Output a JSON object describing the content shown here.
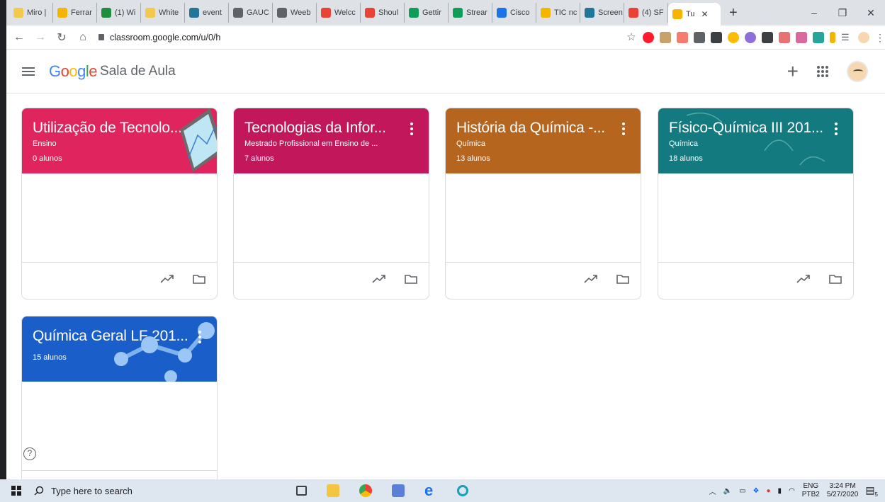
{
  "browser": {
    "tabs": [
      {
        "label": "Miro |",
        "color": "#f2c94c"
      },
      {
        "label": "Ferrar",
        "color": "#f4b400"
      },
      {
        "label": "(1) Wi",
        "color": "#1e8e3e"
      },
      {
        "label": "White",
        "color": "#f2c94c"
      },
      {
        "label": "event",
        "color": "#21759b"
      },
      {
        "label": "GAUC",
        "color": "#5f6368"
      },
      {
        "label": "Weeb",
        "color": "#5f6368"
      },
      {
        "label": "Welcc",
        "color": "#ea4335"
      },
      {
        "label": "Shoul",
        "color": "#ea4335"
      },
      {
        "label": "Gettir",
        "color": "#0f9d58"
      },
      {
        "label": "Strear",
        "color": "#0f9d58"
      },
      {
        "label": "Cisco",
        "color": "#1a73e8"
      },
      {
        "label": "TIC nc",
        "color": "#f4b400"
      },
      {
        "label": "Screen",
        "color": "#21759b"
      },
      {
        "label": "(4) SF",
        "color": "#ea4335"
      },
      {
        "label": "Tu",
        "color": "#f4b400"
      }
    ],
    "new_tab": "+",
    "window_controls": {
      "minimize": "–",
      "restore": "❐",
      "close": "✕"
    },
    "url": "classroom.google.com/u/0/h"
  },
  "header": {
    "logo_letters": [
      {
        "ch": "G",
        "color": "#4285f4"
      },
      {
        "ch": "o",
        "color": "#ea4335"
      },
      {
        "ch": "o",
        "color": "#fbbc05"
      },
      {
        "ch": "g",
        "color": "#4285f4"
      },
      {
        "ch": "l",
        "color": "#34a853"
      },
      {
        "ch": "e",
        "color": "#ea4335"
      }
    ],
    "product": "Sala de Aula",
    "create_label": "+"
  },
  "courses": [
    {
      "title": "Utilização de Tecnolo...",
      "section": "Ensino",
      "students": "0 alunos",
      "color": "#e0245e",
      "theme": "tablet",
      "kebab": false
    },
    {
      "title": "Tecnologias da Infor...",
      "section": "Mestrado Profissional em Ensino de ...",
      "students": "7 alunos",
      "color": "#c2185b",
      "theme": "plain",
      "kebab": true
    },
    {
      "title": "História da Química -...",
      "section": "Química",
      "students": "13 alunos",
      "color": "#b5651d",
      "theme": "plain",
      "kebab": true
    },
    {
      "title": "Físico-Química III 201...",
      "section": "Química",
      "students": "18 alunos",
      "color": "#137a7f",
      "theme": "chalk",
      "kebab": true
    },
    {
      "title": "Química Geral LF 201...",
      "section": "",
      "students": "15 alunos",
      "color": "#1a5fc9",
      "theme": "molecule",
      "kebab": true
    }
  ],
  "help_label": "?",
  "taskbar": {
    "search_placeholder": "Type here to search",
    "lang_top": "ENG",
    "lang_bottom": "PTB2",
    "time": "3:24 PM",
    "date": "5/27/2020",
    "notifications": "5"
  }
}
